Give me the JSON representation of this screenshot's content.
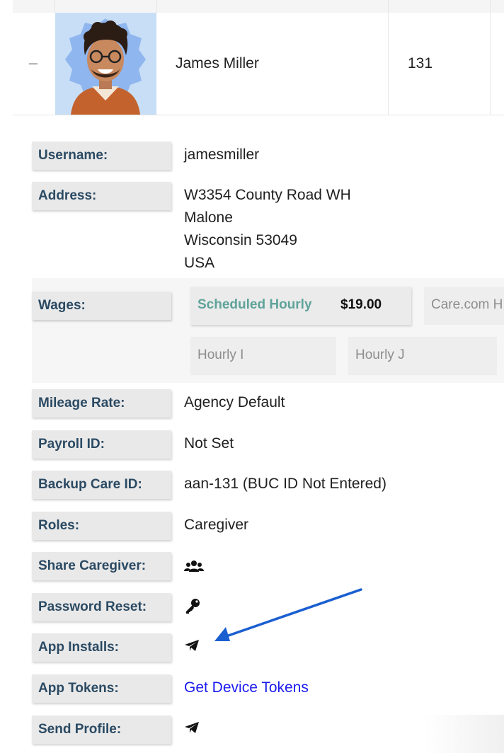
{
  "employee": {
    "name": "James Miller",
    "id": "131"
  },
  "details": {
    "username": {
      "label": "Username:",
      "value": "jamesmiller"
    },
    "address": {
      "label": "Address:",
      "line1": "W3354 County Road WH",
      "city": "Malone",
      "state_zip": "Wisconsin 53049",
      "country": "USA"
    },
    "wages": {
      "label": "Wages:",
      "primary": {
        "type": "Scheduled Hourly",
        "amount": "$19.00"
      },
      "others": [
        "Care.com H",
        "Hourly I",
        "Hourly J"
      ]
    },
    "mileage": {
      "label": "Mileage Rate:",
      "value": "Agency Default"
    },
    "payroll": {
      "label": "Payroll ID:",
      "value": "Not Set"
    },
    "backup": {
      "label": "Backup Care ID:",
      "value": "aan-131 (BUC ID Not Entered)"
    },
    "roles": {
      "label": "Roles:",
      "value": "Caregiver"
    },
    "share": {
      "label": "Share Caregiver:",
      "icon": "users-icon"
    },
    "password": {
      "label": "Password Reset:",
      "icon": "key-icon"
    },
    "installs": {
      "label": "App Installs:",
      "icon": "paper-plane-icon"
    },
    "tokens": {
      "label": "App Tokens:",
      "link": "Get Device Tokens"
    },
    "send_profile": {
      "label": "Send Profile:",
      "icon": "paper-plane-icon"
    }
  },
  "colors": {
    "label_text": "#2b4a63",
    "wage_type": "#5fa39a",
    "link": "#1a1aee",
    "annotation_arrow": "#1a5fd0"
  }
}
